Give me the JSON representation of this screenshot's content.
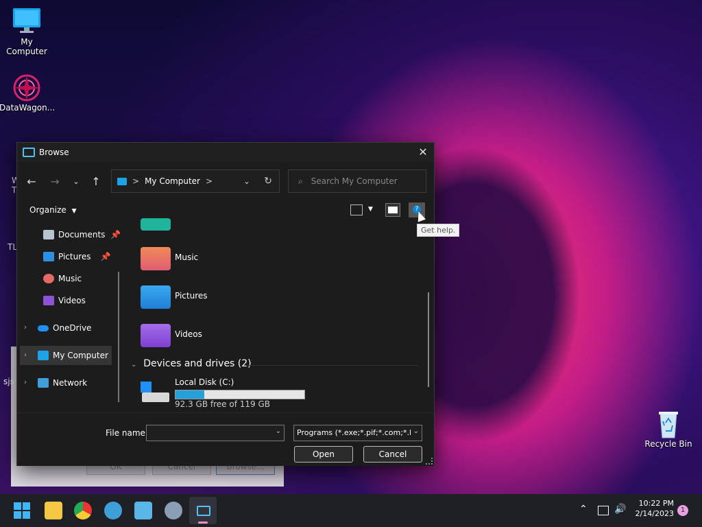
{
  "desktop": {
    "icons": [
      {
        "label": "My Computer"
      },
      {
        "label": "DataWagon..."
      },
      {
        "label": "Recycle Bin"
      }
    ],
    "partial_labels": [
      "W",
      "T",
      "TL",
      "sjs"
    ]
  },
  "background_window": {
    "buttons": [
      "OK",
      "Cancel",
      "Browse..."
    ]
  },
  "dialog": {
    "title": "Browse",
    "address": {
      "location": "My Computer",
      "separator_left": ">",
      "separator_right": ">"
    },
    "search": {
      "placeholder": "Search My Computer"
    },
    "toolbar": {
      "organize_label": "Organize"
    },
    "tooltip": "Get help.",
    "nav_pane": {
      "items": [
        {
          "label": "Documents",
          "pinned": true
        },
        {
          "label": "Pictures",
          "pinned": true
        },
        {
          "label": "Music"
        },
        {
          "label": "Videos"
        },
        {
          "label": "OneDrive"
        },
        {
          "label": "My Computer",
          "selected": true
        },
        {
          "label": "Network"
        }
      ]
    },
    "content": {
      "folders": [
        {
          "name": "Music"
        },
        {
          "name": "Pictures"
        },
        {
          "name": "Videos"
        }
      ],
      "drives_header": "Devices and drives (2)",
      "drive": {
        "name": "Local Disk (C:)",
        "free_text": "92.3 GB free of 119 GB",
        "used_fraction": 0.224
      }
    },
    "bottom": {
      "file_name_label": "File name:",
      "file_name_value": "",
      "filter_value": "Programs (*.exe;*.pif;*.com;*.ba",
      "open_label": "Open",
      "cancel_label": "Cancel"
    }
  },
  "taskbar": {
    "clock_time": "10:22 PM",
    "clock_date": "2/14/2023",
    "notification_count": "1"
  },
  "colors": {
    "accent": "#0a84d4",
    "drive_bar_fill": "#26a0da",
    "dialog_bg": "#1c1c1c"
  }
}
